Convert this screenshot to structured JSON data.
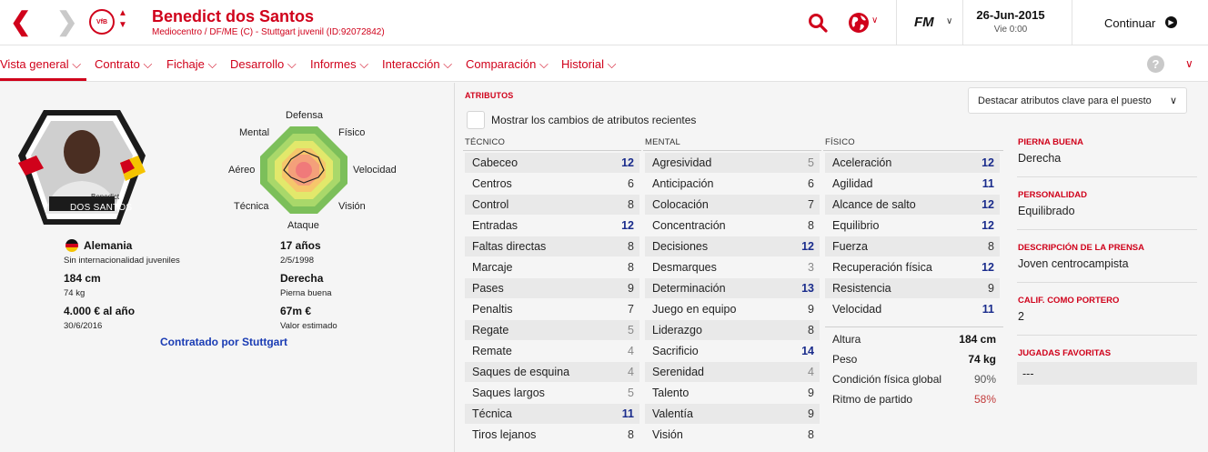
{
  "header": {
    "player_name": "Benedict dos Santos",
    "player_sub": "Mediocentro / DF/ME (C) - Stuttgart juvenil (ID:92072842)",
    "club_crest_text": "VfB",
    "brand": "FM",
    "date": "26-Jun-2015",
    "day": "Vie 0:00",
    "continue_label": "Continuar",
    "icons": [
      "back-arrow-icon",
      "forward-arrow-icon",
      "search-icon",
      "globe-icon",
      "continue-icon"
    ]
  },
  "tabs": [
    {
      "label": "Vista general"
    },
    {
      "label": "Contrato"
    },
    {
      "label": "Fichaje"
    },
    {
      "label": "Desarrollo"
    },
    {
      "label": "Informes"
    },
    {
      "label": "Interacción"
    },
    {
      "label": "Comparación"
    },
    {
      "label": "Historial"
    }
  ],
  "help_label": "?",
  "portrait": {
    "name_line1": "Benedict",
    "name_line2": "DOS SANTOS"
  },
  "radar_labels": {
    "top": "Defensa",
    "upper_left": "Mental",
    "upper_right": "Físico",
    "left": "Aéreo",
    "right": "Velocidad",
    "lower_left": "Técnica",
    "lower_right": "Visión",
    "bottom": "Ataque"
  },
  "info": {
    "nation": "Alemania",
    "nation_sub": "Sin internacionalidad juveniles",
    "height": "184 cm",
    "weight": "74 kg",
    "wage": "4.000 € al año",
    "contract_end": "30/6/2016",
    "age": "17 años",
    "dob": "2/5/1998",
    "foot": "Derecha",
    "foot_sub": "Pierna buena",
    "value": "67m €",
    "value_sub": "Valor estimado",
    "contracted_by": "Contratado por Stuttgart"
  },
  "attributes": {
    "title": "ATRIBUTOS",
    "highlight_dropdown": "Destacar atributos clave para el puesto",
    "show_changes_label": "Mostrar los cambios de atributos recientes",
    "technical": {
      "header": "TÉCNICO",
      "rows": [
        {
          "name": "Cabeceo",
          "value": "12",
          "level": "hi"
        },
        {
          "name": "Centros",
          "value": "6",
          "level": ""
        },
        {
          "name": "Control",
          "value": "8",
          "level": ""
        },
        {
          "name": "Entradas",
          "value": "12",
          "level": "hi"
        },
        {
          "name": "Faltas directas",
          "value": "8",
          "level": ""
        },
        {
          "name": "Marcaje",
          "value": "8",
          "level": ""
        },
        {
          "name": "Pases",
          "value": "9",
          "level": ""
        },
        {
          "name": "Penaltis",
          "value": "7",
          "level": ""
        },
        {
          "name": "Regate",
          "value": "5",
          "level": "lo"
        },
        {
          "name": "Remate",
          "value": "4",
          "level": "lo"
        },
        {
          "name": "Saques de esquina",
          "value": "4",
          "level": "lo"
        },
        {
          "name": "Saques largos",
          "value": "5",
          "level": "lo"
        },
        {
          "name": "Técnica",
          "value": "11",
          "level": "hi"
        },
        {
          "name": "Tiros lejanos",
          "value": "8",
          "level": ""
        }
      ]
    },
    "mental": {
      "header": "MENTAL",
      "rows": [
        {
          "name": "Agresividad",
          "value": "5",
          "level": "lo"
        },
        {
          "name": "Anticipación",
          "value": "6",
          "level": ""
        },
        {
          "name": "Colocación",
          "value": "7",
          "level": ""
        },
        {
          "name": "Concentración",
          "value": "8",
          "level": ""
        },
        {
          "name": "Decisiones",
          "value": "12",
          "level": "hi"
        },
        {
          "name": "Desmarques",
          "value": "3",
          "level": "lo"
        },
        {
          "name": "Determinación",
          "value": "13",
          "level": "hi"
        },
        {
          "name": "Juego en equipo",
          "value": "9",
          "level": ""
        },
        {
          "name": "Liderazgo",
          "value": "8",
          "level": ""
        },
        {
          "name": "Sacrificio",
          "value": "14",
          "level": "hi"
        },
        {
          "name": "Serenidad",
          "value": "4",
          "level": "lo"
        },
        {
          "name": "Talento",
          "value": "9",
          "level": ""
        },
        {
          "name": "Valentía",
          "value": "9",
          "level": ""
        },
        {
          "name": "Visión",
          "value": "8",
          "level": ""
        }
      ]
    },
    "physical": {
      "header": "FÍSICO",
      "rows": [
        {
          "name": "Aceleración",
          "value": "12",
          "level": "hi"
        },
        {
          "name": "Agilidad",
          "value": "11",
          "level": "hi"
        },
        {
          "name": "Alcance de salto",
          "value": "12",
          "level": "hi"
        },
        {
          "name": "Equilibrio",
          "value": "12",
          "level": "hi"
        },
        {
          "name": "Fuerza",
          "value": "8",
          "level": ""
        },
        {
          "name": "Recuperación física",
          "value": "12",
          "level": "hi"
        },
        {
          "name": "Resistencia",
          "value": "9",
          "level": ""
        },
        {
          "name": "Velocidad",
          "value": "11",
          "level": "hi"
        }
      ],
      "extra": [
        {
          "name": "Altura",
          "value": "184 cm"
        },
        {
          "name": "Peso",
          "value": "74 kg"
        },
        {
          "name": "Condición física global",
          "value": "90%"
        },
        {
          "name": "Ritmo de partido",
          "value": "58%"
        }
      ]
    }
  },
  "side": [
    {
      "title": "PIERNA BUENA",
      "value": "Derecha"
    },
    {
      "title": "PERSONALIDAD",
      "value": "Equilibrado"
    },
    {
      "title": "DESCRIPCIÓN DE LA PRENSA",
      "value": "Joven centrocampista"
    },
    {
      "title": "CALIF. COMO PORTERO",
      "value": "2"
    },
    {
      "title": "JUGADAS FAVORITAS",
      "value": "---"
    }
  ],
  "colors": {
    "accent": "#d0021b",
    "high_value": "#1a2c8c",
    "low_value": "#888888",
    "match_rhythm": "#c23b3b"
  }
}
